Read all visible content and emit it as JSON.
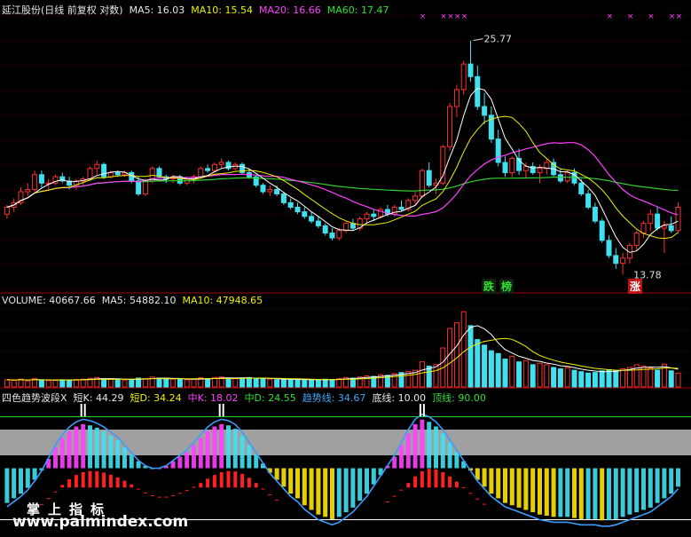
{
  "header_main": {
    "title": "延江股份(日线 前复权 对数)",
    "ma5": "MA5: 16.03",
    "ma10": "MA10: 15.54",
    "ma20": "MA20: 16.66",
    "ma60": "MA60: 17.47"
  },
  "header_volume": {
    "title": "VOLUME: 40667.66",
    "ma5": "MA5: 54882.10",
    "ma10": "MA10: 47948.65"
  },
  "header_indicator": {
    "title": "四色趋势波段X",
    "shortk": "短K: 44.29",
    "shortd": "短D: 34.24",
    "midk": "中K: 18.02",
    "midd": "中D: 24.55",
    "trend": "趋势线: 34.67",
    "bottom": "底线: 10.00",
    "top": "顶线: 90.00"
  },
  "annotations": {
    "high": "25.77",
    "low": "13.78",
    "tag_drop": "跌",
    "tag_list": "榜",
    "tag_rise": "涨"
  },
  "watermark": {
    "line1": "掌上指标",
    "line2": "www.palmindex.com"
  },
  "colors": {
    "up": "#ff3030",
    "down": "#40e0f0",
    "ma5": "#ffffff",
    "ma10": "#f0f000",
    "ma20": "#ff40ff",
    "ma60": "#30d030",
    "trend": "#3a9cff",
    "band": "#a0a0a0"
  },
  "chart_data": [
    {
      "type": "candlestick",
      "title": "延江股份(日线 前复权 对数)",
      "y_scale": "log",
      "ylim": [
        13.5,
        27
      ],
      "high_label": 25.77,
      "low_label": 13.78,
      "ohlc": [
        [
          16.2,
          16.6,
          16.0,
          16.5
        ],
        [
          16.5,
          16.9,
          16.3,
          16.7
        ],
        [
          16.7,
          17.4,
          16.6,
          17.2
        ],
        [
          17.2,
          17.6,
          17.0,
          17.3
        ],
        [
          17.3,
          18.2,
          17.2,
          18.0
        ],
        [
          18.0,
          18.2,
          17.4,
          17.6
        ],
        [
          17.6,
          17.8,
          17.3,
          17.6
        ],
        [
          17.6,
          18.0,
          17.5,
          17.9
        ],
        [
          17.9,
          18.1,
          17.6,
          17.7
        ],
        [
          17.7,
          17.9,
          17.3,
          17.5
        ],
        [
          17.5,
          17.8,
          17.3,
          17.7
        ],
        [
          17.7,
          17.9,
          17.5,
          17.8
        ],
        [
          17.8,
          18.4,
          17.7,
          18.3
        ],
        [
          18.3,
          18.7,
          18.0,
          18.5
        ],
        [
          18.5,
          18.6,
          17.8,
          17.9
        ],
        [
          17.9,
          18.2,
          17.8,
          18.1
        ],
        [
          18.1,
          18.2,
          17.9,
          18.0
        ],
        [
          18.0,
          18.2,
          17.9,
          18.1
        ],
        [
          18.1,
          18.2,
          17.6,
          17.7
        ],
        [
          17.7,
          17.9,
          17.0,
          17.1
        ],
        [
          17.1,
          17.8,
          17.0,
          17.7
        ],
        [
          17.7,
          18.4,
          17.6,
          18.3
        ],
        [
          18.3,
          18.4,
          17.8,
          17.9
        ],
        [
          17.9,
          18.0,
          17.6,
          17.8
        ],
        [
          17.8,
          18.0,
          17.6,
          17.9
        ],
        [
          17.9,
          18.0,
          17.5,
          17.6
        ],
        [
          17.6,
          17.9,
          17.5,
          17.8
        ],
        [
          17.8,
          18.0,
          17.6,
          17.9
        ],
        [
          17.9,
          18.4,
          17.8,
          18.3
        ],
        [
          18.3,
          18.5,
          18.1,
          18.2
        ],
        [
          18.2,
          18.6,
          18.1,
          18.5
        ],
        [
          18.5,
          18.8,
          18.3,
          18.6
        ],
        [
          18.6,
          18.7,
          18.2,
          18.3
        ],
        [
          18.3,
          18.6,
          18.2,
          18.5
        ],
        [
          18.5,
          18.6,
          18.0,
          18.1
        ],
        [
          18.1,
          18.3,
          17.8,
          17.9
        ],
        [
          17.9,
          18.0,
          17.4,
          17.5
        ],
        [
          17.5,
          17.6,
          17.1,
          17.2
        ],
        [
          17.2,
          17.5,
          17.0,
          17.3
        ],
        [
          17.3,
          17.5,
          17.0,
          17.1
        ],
        [
          17.1,
          17.2,
          16.6,
          16.7
        ],
        [
          16.7,
          16.9,
          16.4,
          16.5
        ],
        [
          16.5,
          16.7,
          16.2,
          16.3
        ],
        [
          16.3,
          16.5,
          16.0,
          16.1
        ],
        [
          16.1,
          16.3,
          15.8,
          15.9
        ],
        [
          15.9,
          16.1,
          15.6,
          15.7
        ],
        [
          15.7,
          15.8,
          15.3,
          15.4
        ],
        [
          15.4,
          15.6,
          15.1,
          15.2
        ],
        [
          15.2,
          15.6,
          15.1,
          15.5
        ],
        [
          15.5,
          15.9,
          15.4,
          15.8
        ],
        [
          15.8,
          16.0,
          15.5,
          15.6
        ],
        [
          15.6,
          16.1,
          15.5,
          16.0
        ],
        [
          16.0,
          16.3,
          15.8,
          16.2
        ],
        [
          16.2,
          16.4,
          15.9,
          16.1
        ],
        [
          16.1,
          16.5,
          16.0,
          16.4
        ],
        [
          16.4,
          16.6,
          16.1,
          16.2
        ],
        [
          16.2,
          16.6,
          16.1,
          16.5
        ],
        [
          16.5,
          16.8,
          16.3,
          16.4
        ],
        [
          16.4,
          16.9,
          16.3,
          16.8
        ],
        [
          16.8,
          17.2,
          16.6,
          17.0
        ],
        [
          17.0,
          18.3,
          16.9,
          18.2
        ],
        [
          18.2,
          18.6,
          17.4,
          17.5
        ],
        [
          17.5,
          17.8,
          17.1,
          17.6
        ],
        [
          17.6,
          19.5,
          17.5,
          19.4
        ],
        [
          19.4,
          21.8,
          19.2,
          21.6
        ],
        [
          21.6,
          22.9,
          21.0,
          22.6
        ],
        [
          22.6,
          24.4,
          22.3,
          24.2
        ],
        [
          24.2,
          25.77,
          23.1,
          23.4
        ],
        [
          23.4,
          24.1,
          21.4,
          21.6
        ],
        [
          21.6,
          22.4,
          20.6,
          21.1
        ],
        [
          21.1,
          21.6,
          19.6,
          19.8
        ],
        [
          19.8,
          20.3,
          18.4,
          18.6
        ],
        [
          18.6,
          18.9,
          17.9,
          18.1
        ],
        [
          18.1,
          18.9,
          17.9,
          18.8
        ],
        [
          18.8,
          19.3,
          18.0,
          18.2
        ],
        [
          18.2,
          18.6,
          17.8,
          18.4
        ],
        [
          18.4,
          18.6,
          18.0,
          18.1
        ],
        [
          18.1,
          18.5,
          17.6,
          18.3
        ],
        [
          18.3,
          18.8,
          18.0,
          18.6
        ],
        [
          18.6,
          18.8,
          17.9,
          18.0
        ],
        [
          18.0,
          18.3,
          17.6,
          17.7
        ],
        [
          17.7,
          18.2,
          17.6,
          18.1
        ],
        [
          18.1,
          18.3,
          17.5,
          17.6
        ],
        [
          17.6,
          17.8,
          17.0,
          17.1
        ],
        [
          17.1,
          17.3,
          16.4,
          16.5
        ],
        [
          16.5,
          16.7,
          15.8,
          15.9
        ],
        [
          15.9,
          16.0,
          15.0,
          15.1
        ],
        [
          15.1,
          15.3,
          14.4,
          14.5
        ],
        [
          14.5,
          14.8,
          14.0,
          14.2
        ],
        [
          14.2,
          14.6,
          13.78,
          14.4
        ],
        [
          14.4,
          15.0,
          14.2,
          14.9
        ],
        [
          14.9,
          15.5,
          14.7,
          15.4
        ],
        [
          15.4,
          15.9,
          15.2,
          15.8
        ],
        [
          15.8,
          16.4,
          15.5,
          16.2
        ],
        [
          16.2,
          16.5,
          15.5,
          15.6
        ],
        [
          15.6,
          15.9,
          14.6,
          15.7
        ],
        [
          15.7,
          16.1,
          15.4,
          15.5
        ],
        [
          15.5,
          16.7,
          15.4,
          16.5
        ]
      ]
    },
    {
      "type": "bar",
      "title": "VOLUME",
      "values": [
        2.6,
        2.4,
        2.8,
        2.2,
        3.0,
        2.5,
        2.3,
        2.4,
        2.6,
        2.5,
        2.7,
        2.8,
        3.1,
        3.4,
        3.0,
        2.7,
        2.6,
        2.5,
        2.8,
        3.2,
        3.0,
        3.6,
        3.2,
        2.9,
        2.8,
        2.7,
        2.6,
        2.8,
        3.3,
        3.0,
        3.4,
        3.6,
        3.1,
        3.0,
        3.2,
        3.4,
        3.1,
        2.9,
        2.8,
        2.6,
        2.7,
        2.9,
        2.6,
        2.5,
        2.4,
        2.6,
        2.8,
        2.7,
        3.0,
        3.4,
        3.2,
        3.6,
        4.0,
        3.8,
        4.4,
        4.2,
        4.8,
        5.2,
        5.6,
        6.0,
        9.0,
        7.5,
        8.0,
        14.0,
        21.0,
        23.0,
        27.0,
        22.0,
        17.0,
        15.0,
        13.0,
        12.0,
        10.0,
        11.0,
        9.0,
        9.5,
        8.0,
        8.5,
        8.0,
        7.0,
        6.5,
        7.0,
        6.0,
        5.5,
        5.0,
        5.2,
        5.8,
        6.2,
        6.0,
        6.5,
        7.0,
        8.0,
        7.5,
        6.8,
        6.0,
        8.2,
        5.8,
        5.0
      ]
    },
    {
      "type": "line",
      "title": "四色趋势波段X",
      "ylim": [
        0,
        100
      ],
      "bottom_line": 10,
      "top_line": 90,
      "trend": [
        20,
        24,
        28,
        33,
        40,
        48,
        58,
        68,
        76,
        82,
        86,
        88,
        87,
        85,
        82,
        78,
        74,
        68,
        62,
        56,
        52,
        50,
        50,
        52,
        56,
        60,
        64,
        70,
        76,
        82,
        86,
        88,
        87,
        84,
        78,
        70,
        62,
        54,
        46,
        40,
        34,
        28,
        24,
        18,
        14,
        10,
        8,
        6,
        8,
        12,
        16,
        22,
        28,
        36,
        44,
        52,
        60,
        70,
        80,
        88,
        92,
        90,
        86,
        80,
        72,
        64,
        56,
        48,
        40,
        34,
        28,
        24,
        20,
        18,
        16,
        14,
        12,
        10,
        9,
        8,
        8,
        8,
        7,
        6,
        6,
        6,
        5,
        5,
        6,
        8,
        10,
        12,
        14,
        16,
        20,
        24,
        28,
        34
      ],
      "short_k": [
        44.29
      ],
      "short_d": [
        34.24
      ],
      "mid_k": [
        18.02
      ],
      "mid_d": [
        24.55
      ]
    }
  ]
}
